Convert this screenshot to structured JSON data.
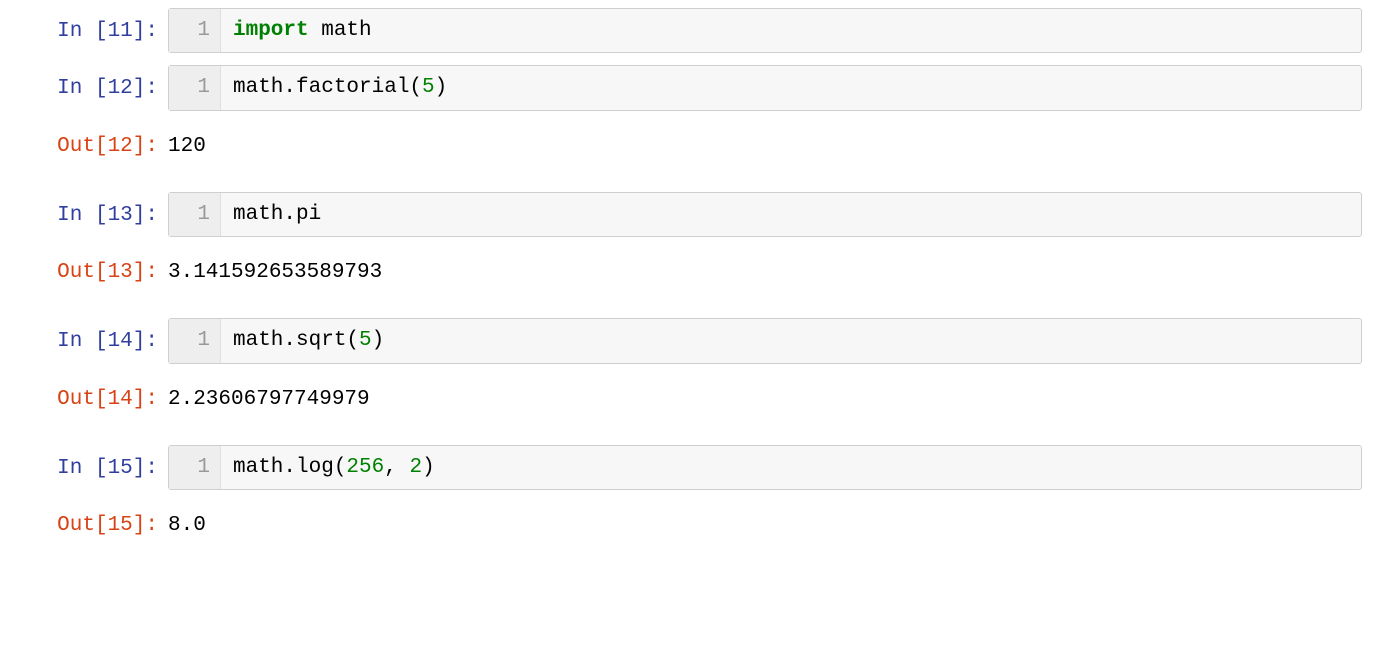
{
  "cells": [
    {
      "type": "in",
      "n": 11,
      "gutter": "1",
      "tokens": [
        {
          "cls": "kw",
          "t": "import"
        },
        {
          "cls": "plain",
          "t": " math"
        }
      ]
    },
    {
      "type": "in",
      "n": 12,
      "gutter": "1",
      "tokens": [
        {
          "cls": "plain",
          "t": "math.factorial("
        },
        {
          "cls": "num",
          "t": "5"
        },
        {
          "cls": "plain",
          "t": ")"
        }
      ]
    },
    {
      "type": "out",
      "n": 12,
      "value": "120"
    },
    {
      "type": "in",
      "n": 13,
      "gutter": "1",
      "tokens": [
        {
          "cls": "plain",
          "t": "math.pi"
        }
      ]
    },
    {
      "type": "out",
      "n": 13,
      "value": "3.141592653589793"
    },
    {
      "type": "in",
      "n": 14,
      "gutter": "1",
      "tokens": [
        {
          "cls": "plain",
          "t": "math.sqrt("
        },
        {
          "cls": "num",
          "t": "5"
        },
        {
          "cls": "plain",
          "t": ")"
        }
      ]
    },
    {
      "type": "out",
      "n": 14,
      "value": "2.23606797749979"
    },
    {
      "type": "in",
      "n": 15,
      "gutter": "1",
      "tokens": [
        {
          "cls": "plain",
          "t": "math.log("
        },
        {
          "cls": "num",
          "t": "256"
        },
        {
          "cls": "plain",
          "t": ", "
        },
        {
          "cls": "num",
          "t": "2"
        },
        {
          "cls": "plain",
          "t": ")"
        }
      ]
    },
    {
      "type": "out",
      "n": 15,
      "value": "8.0"
    }
  ],
  "labels": {
    "in": "In ",
    "out": "Out"
  }
}
